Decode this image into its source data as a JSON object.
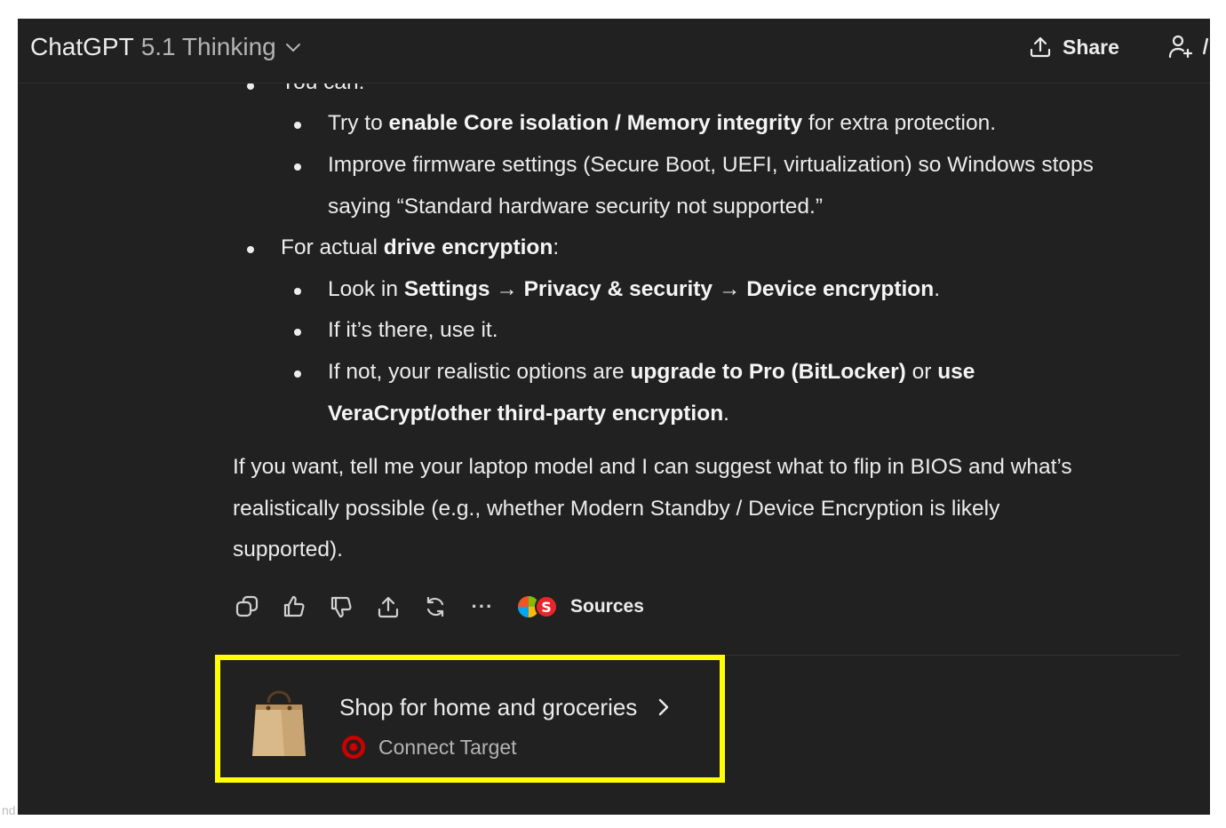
{
  "header": {
    "app_name": "ChatGPT",
    "model_version": "5.1 Thinking",
    "share_label": "Share"
  },
  "message": {
    "partial_top": "You can:",
    "item1_pre": "Try to ",
    "item1_bold": "enable Core isolation / Memory integrity",
    "item1_post": " for extra protection.",
    "item2_line1": "Improve firmware settings (Secure Boot, UEFI, virtualization) so Windows stops",
    "item2_line2": "saying “Standard hardware security not supported.”",
    "drive_pre": "For actual ",
    "drive_bold": "drive encryption",
    "drive_post": ":",
    "look_pre": "Look in ",
    "look_b1": "Settings",
    "look_arrow1": " → ",
    "look_b2": "Privacy & security",
    "look_arrow2": " → ",
    "look_b3": "Device encryption",
    "look_post": ".",
    "if_there": "If it’s there, use it.",
    "ifnot_pre": "If not, your realistic options are ",
    "ifnot_b1": "upgrade to Pro (BitLocker)",
    "ifnot_mid": " or ",
    "ifnot_b2": "use",
    "ifnot_b3": "VeraCrypt/other third-party encryption",
    "ifnot_post": ".",
    "closing_line1": "If you want, tell me your laptop model and I can suggest what to flip in BIOS and what’s",
    "closing_line2": "realistically possible (e.g., whether Modern Standby / Device Encryption is likely",
    "closing_line3": "supported)."
  },
  "actions": {
    "sources_label": "Sources",
    "sources_badge": "S",
    "more_label": "···"
  },
  "suggestion_card": {
    "title": "Shop for home and groceries",
    "subtitle": "Connect Target"
  },
  "stray_text": "nd",
  "colors": {
    "background": "#212121",
    "highlight_border": "#ffff00",
    "target_red": "#cc0000"
  }
}
